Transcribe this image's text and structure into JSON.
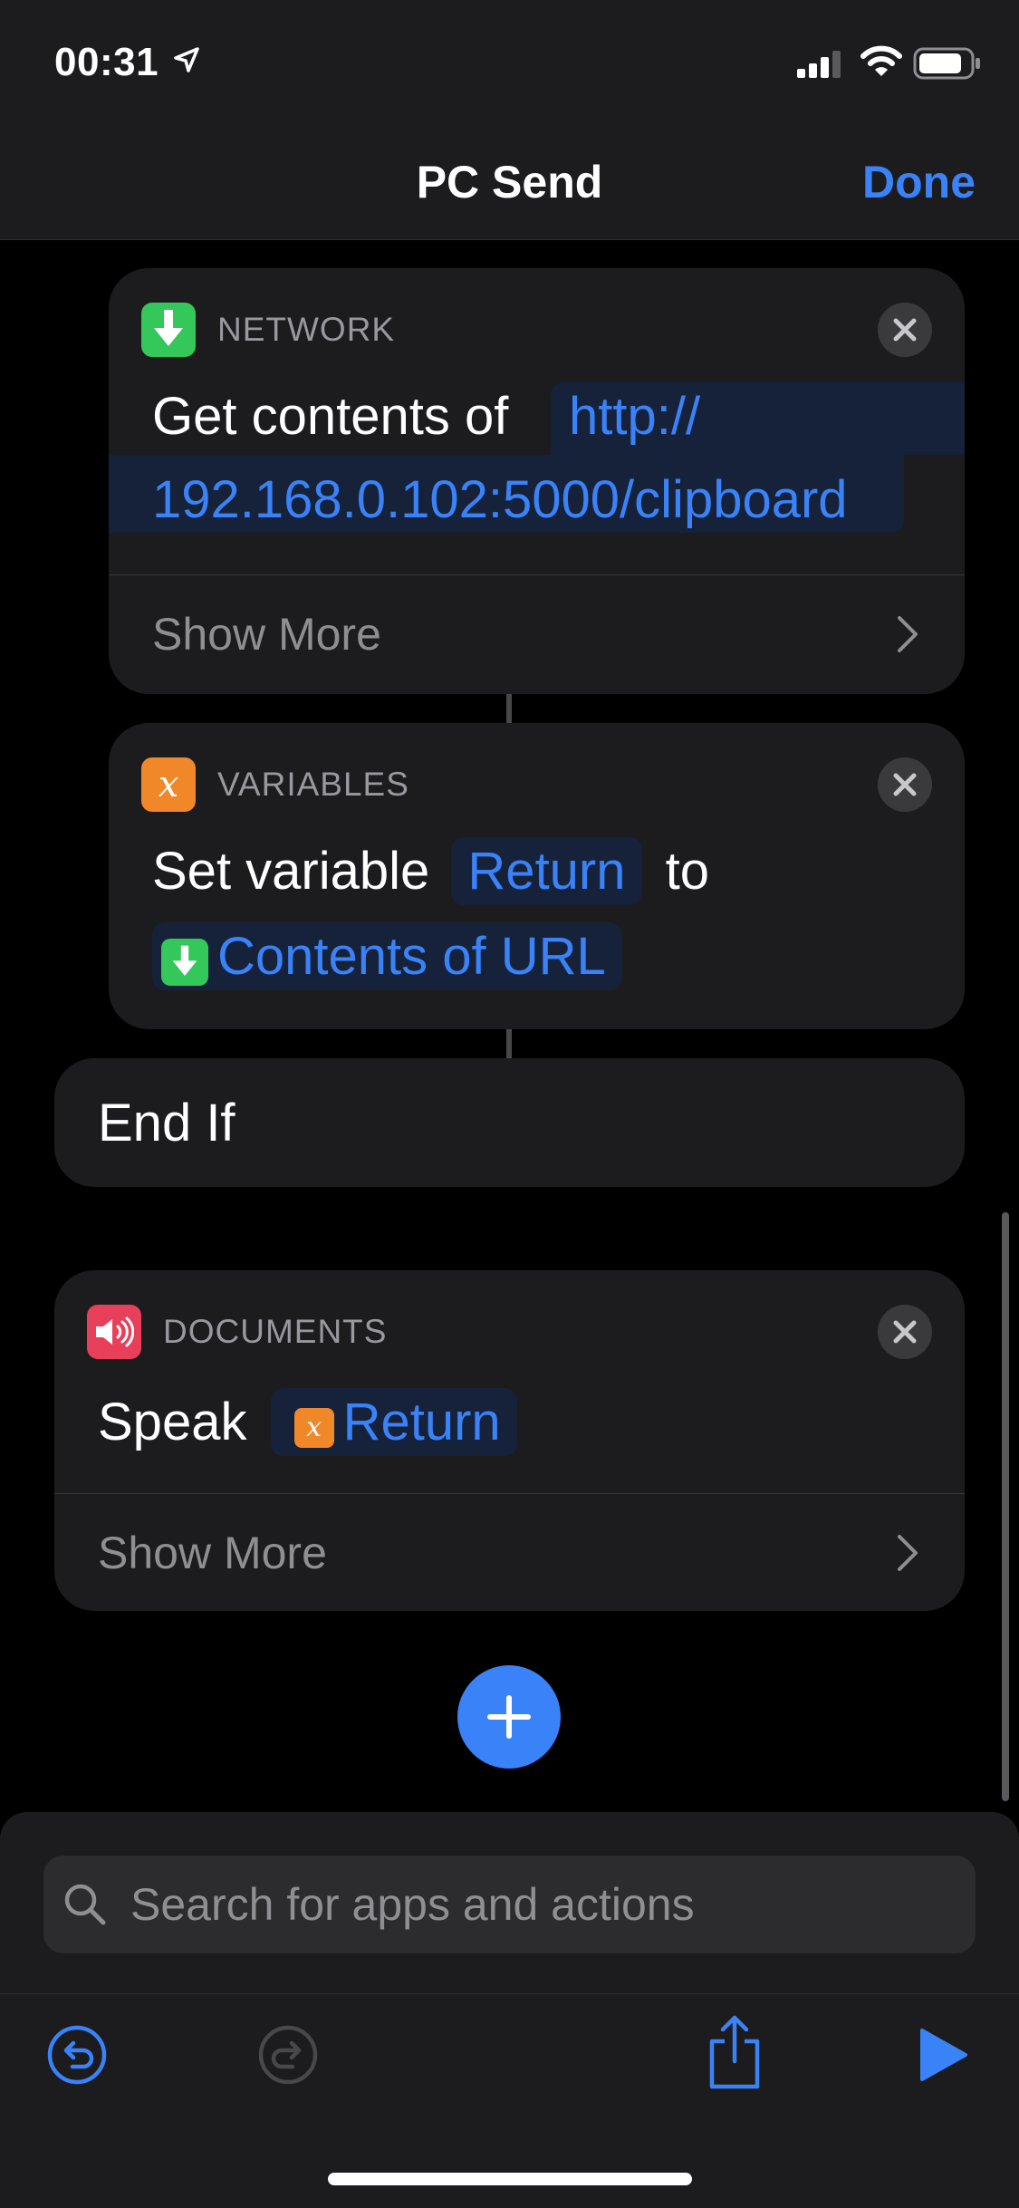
{
  "status_bar": {
    "time": "00:31"
  },
  "nav": {
    "title": "PC Send",
    "done": "Done"
  },
  "network_card": {
    "category": "NETWORK",
    "prefix": "Get contents of",
    "url_line1": "http://",
    "url_line2": "192.168.0.102:5000/clipboard",
    "show_more": "Show More"
  },
  "variables_card": {
    "category": "VARIABLES",
    "prefix": "Set variable",
    "variable": "Return",
    "to": "to",
    "value": "Contents of URL"
  },
  "end_if": {
    "label": "End If"
  },
  "documents_card": {
    "category": "DOCUMENTS",
    "prefix": "Speak",
    "variable": "Return",
    "show_more": "Show More"
  },
  "search": {
    "placeholder": "Search for apps and actions"
  },
  "colors": {
    "accent": "#3a82f7",
    "network": "#34c759",
    "variables": "#f0882a",
    "documents": "#e8405a"
  }
}
